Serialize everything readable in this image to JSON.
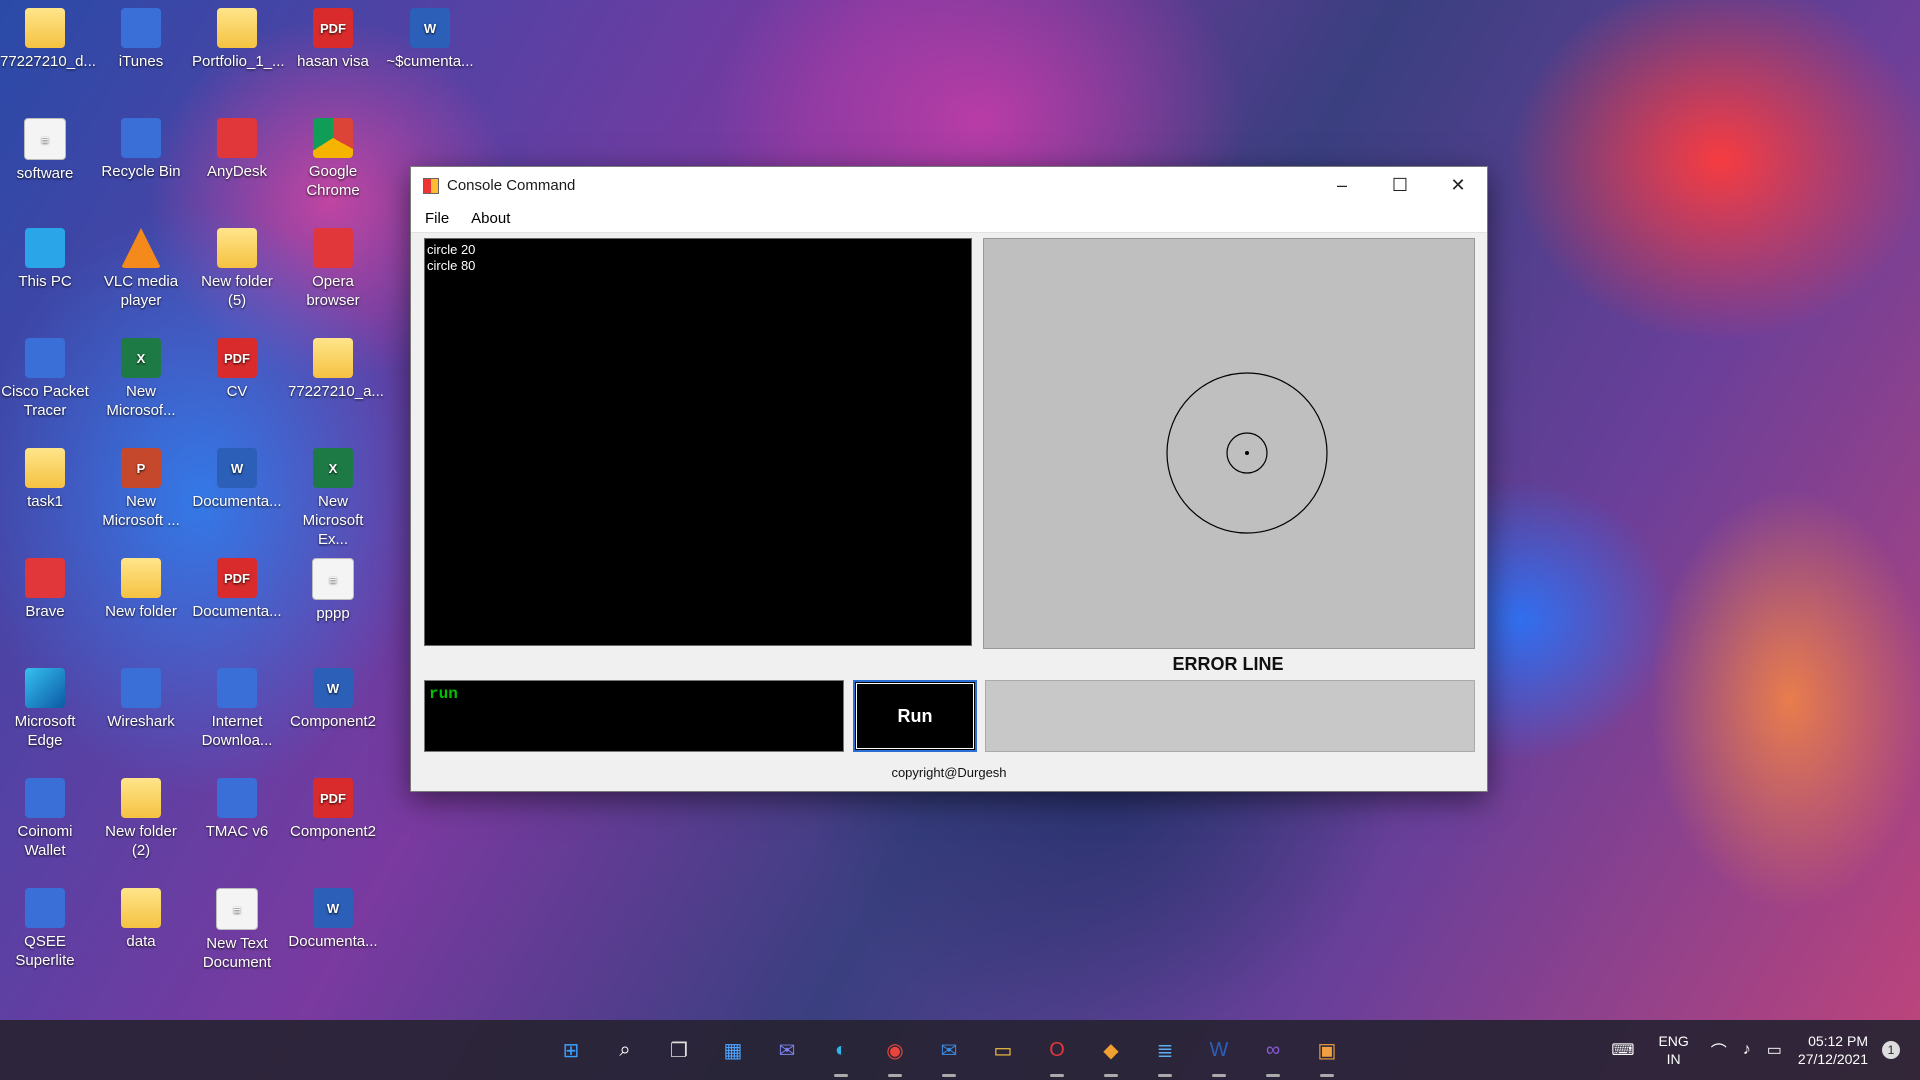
{
  "desktop": {
    "icons": [
      {
        "label": "77227210_d...",
        "kind": "folder"
      },
      {
        "label": "iTunes",
        "kind": "app"
      },
      {
        "label": "Portfolio_1_...",
        "kind": "folder"
      },
      {
        "label": "hasan visa",
        "kind": "pdf"
      },
      {
        "label": "~$cumenta...",
        "kind": "word"
      },
      {
        "label": "software",
        "kind": "doc"
      },
      {
        "label": "Recycle Bin",
        "kind": "app"
      },
      {
        "label": "AnyDesk",
        "kind": "red"
      },
      {
        "label": "Google Chrome",
        "kind": "chrome"
      },
      {
        "label": "This PC",
        "kind": "pc"
      },
      {
        "label": "VLC media player",
        "kind": "vlc"
      },
      {
        "label": "New folder (5)",
        "kind": "folder"
      },
      {
        "label": "Opera browser",
        "kind": "red"
      },
      {
        "label": "Cisco Packet Tracer",
        "kind": "app"
      },
      {
        "label": "New Microsof...",
        "kind": "excel"
      },
      {
        "label": "CV",
        "kind": "pdf"
      },
      {
        "label": "77227210_a...",
        "kind": "folder"
      },
      {
        "label": "task1",
        "kind": "folder"
      },
      {
        "label": "New Microsoft ...",
        "kind": "ppt"
      },
      {
        "label": "Documenta...",
        "kind": "word"
      },
      {
        "label": "New Microsoft Ex...",
        "kind": "excel"
      },
      {
        "label": "Brave",
        "kind": "red"
      },
      {
        "label": "New folder",
        "kind": "folder"
      },
      {
        "label": "Documenta...",
        "kind": "pdf"
      },
      {
        "label": "pppp",
        "kind": "doc"
      },
      {
        "label": "Microsoft Edge",
        "kind": "edge"
      },
      {
        "label": "Wireshark",
        "kind": "app"
      },
      {
        "label": "Internet Downloa...",
        "kind": "app"
      },
      {
        "label": "Component2",
        "kind": "word"
      },
      {
        "label": "Coinomi Wallet",
        "kind": "app"
      },
      {
        "label": "New folder (2)",
        "kind": "folder"
      },
      {
        "label": "TMAC v6",
        "kind": "app"
      },
      {
        "label": "Component2",
        "kind": "pdf"
      },
      {
        "label": "QSEE Superlite",
        "kind": "app"
      },
      {
        "label": "data",
        "kind": "folder"
      },
      {
        "label": "New Text Document",
        "kind": "doc"
      },
      {
        "label": "Documenta...",
        "kind": "word"
      }
    ]
  },
  "window": {
    "title": "Console Command",
    "menu": {
      "file": "File",
      "about": "About"
    },
    "console_lines": [
      "circle 20",
      "circle 80"
    ],
    "canvas": {
      "shapes": [
        {
          "type": "circle",
          "radius": 20
        },
        {
          "type": "circle",
          "radius": 80
        }
      ]
    },
    "error_label": "ERROR LINE",
    "error_text": "",
    "command_value": "run",
    "run_label": "Run",
    "copyright": "copyright@Durgesh"
  },
  "taskbar": {
    "apps": [
      {
        "name": "start-icon",
        "glyph": "⊞",
        "color": "#3aa0ff"
      },
      {
        "name": "search-icon",
        "glyph": "⌕",
        "color": "#ffffff"
      },
      {
        "name": "task-view-icon",
        "glyph": "❐",
        "color": "#dddddd"
      },
      {
        "name": "widgets-icon",
        "glyph": "▦",
        "color": "#4ea3ff"
      },
      {
        "name": "teams-chat-icon",
        "glyph": "✉",
        "color": "#7b83eb"
      },
      {
        "name": "edge-icon",
        "glyph": "◐",
        "color": "#2fb5e8"
      },
      {
        "name": "chrome-icon",
        "glyph": "◉",
        "color": "#e8453c"
      },
      {
        "name": "mail-icon",
        "glyph": "✉",
        "color": "#3a8ee6"
      },
      {
        "name": "file-explorer-icon",
        "glyph": "▭",
        "color": "#f5c242"
      },
      {
        "name": "opera-icon",
        "glyph": "O",
        "color": "#e1373b"
      },
      {
        "name": "git-icon",
        "glyph": "◆",
        "color": "#f0a030"
      },
      {
        "name": "notepad-icon",
        "glyph": "≣",
        "color": "#5ab0f0"
      },
      {
        "name": "word-icon",
        "glyph": "W",
        "color": "#2b5fb8"
      },
      {
        "name": "visual-studio-icon",
        "glyph": "∞",
        "color": "#8a5cd6"
      },
      {
        "name": "console-command-app-icon",
        "glyph": "▣",
        "color": "#f0a040"
      }
    ],
    "tray": {
      "lang_top": "ENG",
      "lang_bottom": "IN",
      "time": "05:12 PM",
      "date": "27/12/2021",
      "notification_count": "1"
    }
  }
}
